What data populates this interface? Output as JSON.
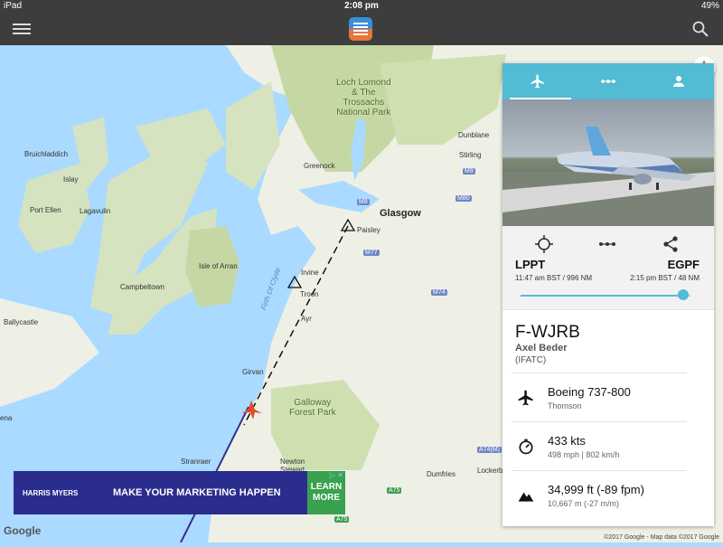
{
  "status_bar": {
    "device": "iPad",
    "time": "2:08 pm",
    "battery": "49%"
  },
  "app_bar": {
    "menu_icon": "hamburger-icon",
    "logo_icon": "app-logo-icon",
    "search_icon": "search-icon"
  },
  "map": {
    "places": {
      "loch_lomond": "Loch Lomond\n& The\nTrossachs\nNational Park",
      "dunblane": "Dunblane",
      "bruichladdich": "Bruichladdich",
      "greenock": "Greenock",
      "stirling": "Stirling",
      "islay": "Islay",
      "glasgow": "Glasgow",
      "port_ellen": "Port Ellen",
      "lagavulin": "Lagavulin",
      "paisley": "Paisley",
      "isle_of_arran": "Isle of Arran",
      "campbeltown": "Campbeltown",
      "irvine": "Irvine",
      "troon": "Troon",
      "ballycastle": "Ballycastle",
      "ayr": "Ayr",
      "girvan": "Girvan",
      "galloway": "Galloway\nForest Park",
      "stranraer": "Stranraer",
      "newton_stewart": "Newton\nStewart",
      "dumfries": "Dumfries",
      "lockerbie": "Lockerbi",
      "ena": "ena"
    },
    "water_label": "Firth Of Clyde",
    "roads": [
      "M9",
      "M80",
      "M8",
      "M77",
      "M74",
      "A74(M)",
      "A75",
      "A75"
    ],
    "copyright": "©2017 Google - Map data ©2017 Google",
    "google_logo": "Google"
  },
  "ad": {
    "brand": "HARRIS MYERS",
    "message": "MAKE YOUR MARKETING HAPPEN",
    "cta": "LEARN MORE",
    "close": "▷ ✕"
  },
  "panel": {
    "tabs": [
      {
        "icon": "airplane-icon",
        "active": true
      },
      {
        "icon": "route-icon",
        "active": false
      },
      {
        "icon": "person-icon",
        "active": false
      }
    ],
    "route": {
      "origin": "LPPT",
      "origin_time": "11:47 am BST / 996 NM",
      "destination": "EGPF",
      "destination_time": "2:15 pm BST / 48 NM",
      "progress": 0.96
    },
    "flight": {
      "registration": "F-WJRB",
      "pilot": "Axel Beder",
      "network": "(IFATC)"
    },
    "details": [
      {
        "icon": "airplane-icon",
        "main": "Boeing 737-800",
        "sub": "Thomson"
      },
      {
        "icon": "speed-icon",
        "main": "433 kts",
        "sub": "498 mph | 802 km/h"
      },
      {
        "icon": "altitude-icon",
        "main": "34,999 ft (-89 fpm)",
        "sub": "10,667 m (-27 m/m)"
      }
    ]
  },
  "colors": {
    "sea": "#aadaff",
    "accent": "#52bcd4",
    "appbar": "#3d3d3d"
  }
}
